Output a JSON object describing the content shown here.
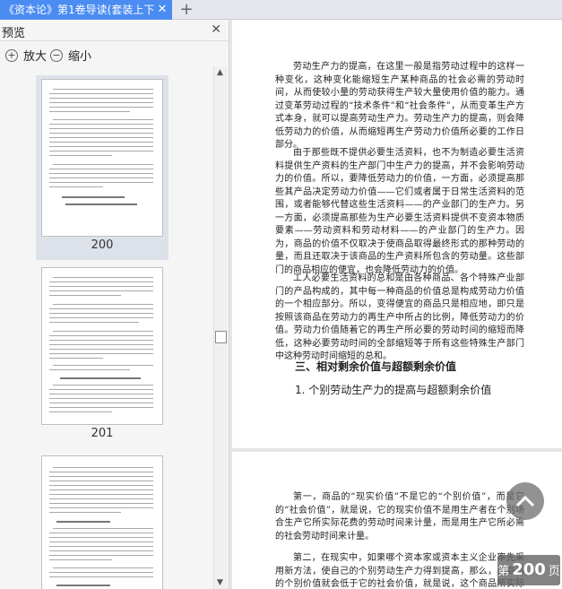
{
  "tab": {
    "title": "《资本论》第1卷导读(套装上下",
    "close": "✕"
  },
  "new_tab": "+",
  "panel": {
    "title": "预览",
    "close": "✕",
    "zoom_in": "放大",
    "zoom_out": "缩小"
  },
  "thumbnails": [
    {
      "page": "200",
      "selected": true
    },
    {
      "page": "201",
      "selected": false
    }
  ],
  "document": {
    "p1": "劳动生产力的提高，在这里一般是指劳动过程中的这样一种变化，这种变化能缩短生产某种商品的社会必需的劳动时间，从而使较小量的劳动获得生产较大量使用价值的能力。通过变革劳动过程的“技术条件”和“社会条件”，从而变革生产方式本身，就可以提高劳动生产力。劳动生产力的提高，则会降低劳动力的价值，从而缩短再生产劳动力价值所必要的工作日部分。",
    "p2": "由于那些既不提供必要生活资料，也不为制造必要生活资料提供生产资料的生产部门中生产力的提高，并不会影响劳动力的价值。所以，要降低劳动力的价值，一方面，必须提高那些其产品决定劳动力价值——它们或者属于日常生活资料的范围，或者能够代替这些生活资料——的产业部门的生产力。另一方面，必须提高那些为生产必要生活资料提供不变资本物质要素——劳动资料和劳动材料——的产业部门的生产力。因为，商品的价值不仅取决于使商品取得最终形式的那种劳动的量，而且还取决于该商品的生产资料所包含的劳动量。这些部门的商品相应的便宜，也会降低劳动力的价值。",
    "p3": "工人必要生活资料的总和是由各种商品、各个特殊产业部门的产品构成的，其中每一种商品的价值总是构成劳动力价值的一个相应部分。所以，变得便宜的商品只是相应地，即只是按照该商品在劳动力的再生产中所占的比例，降低劳动力的价值。劳动力价值随着它的再生产所必要的劳动时间的缩短而降低，这种必要劳动时间的全部缩短等于所有这些特殊生产部门中这种劳动时间缩短的总和。",
    "h3": "三、相对剩余价值与超额剩余价值",
    "h4": "1.  个别劳动生产力的提高与超额剩余价值",
    "p4": "第一，商品的“现实价值”不是它的“个别价值”，而是它的“社会价值”，就是说，它的现实价值不是用生产者在个别场合生产它所实际花费的劳动时间来计量，而是用生产它所必需的社会劳动时间来计量。",
    "p5": "第二，在现实中，如果哪个资本家或资本主义企业率先采用新方法，使自己的个别劳动生产力得到提高，那么，其商品的个别价值就会低于它的社会价值，就是说，这个商品所实际花费的劳动时间，要少"
  },
  "page_indicator": {
    "prefix": "第",
    "number": "200",
    "suffix": "页"
  }
}
